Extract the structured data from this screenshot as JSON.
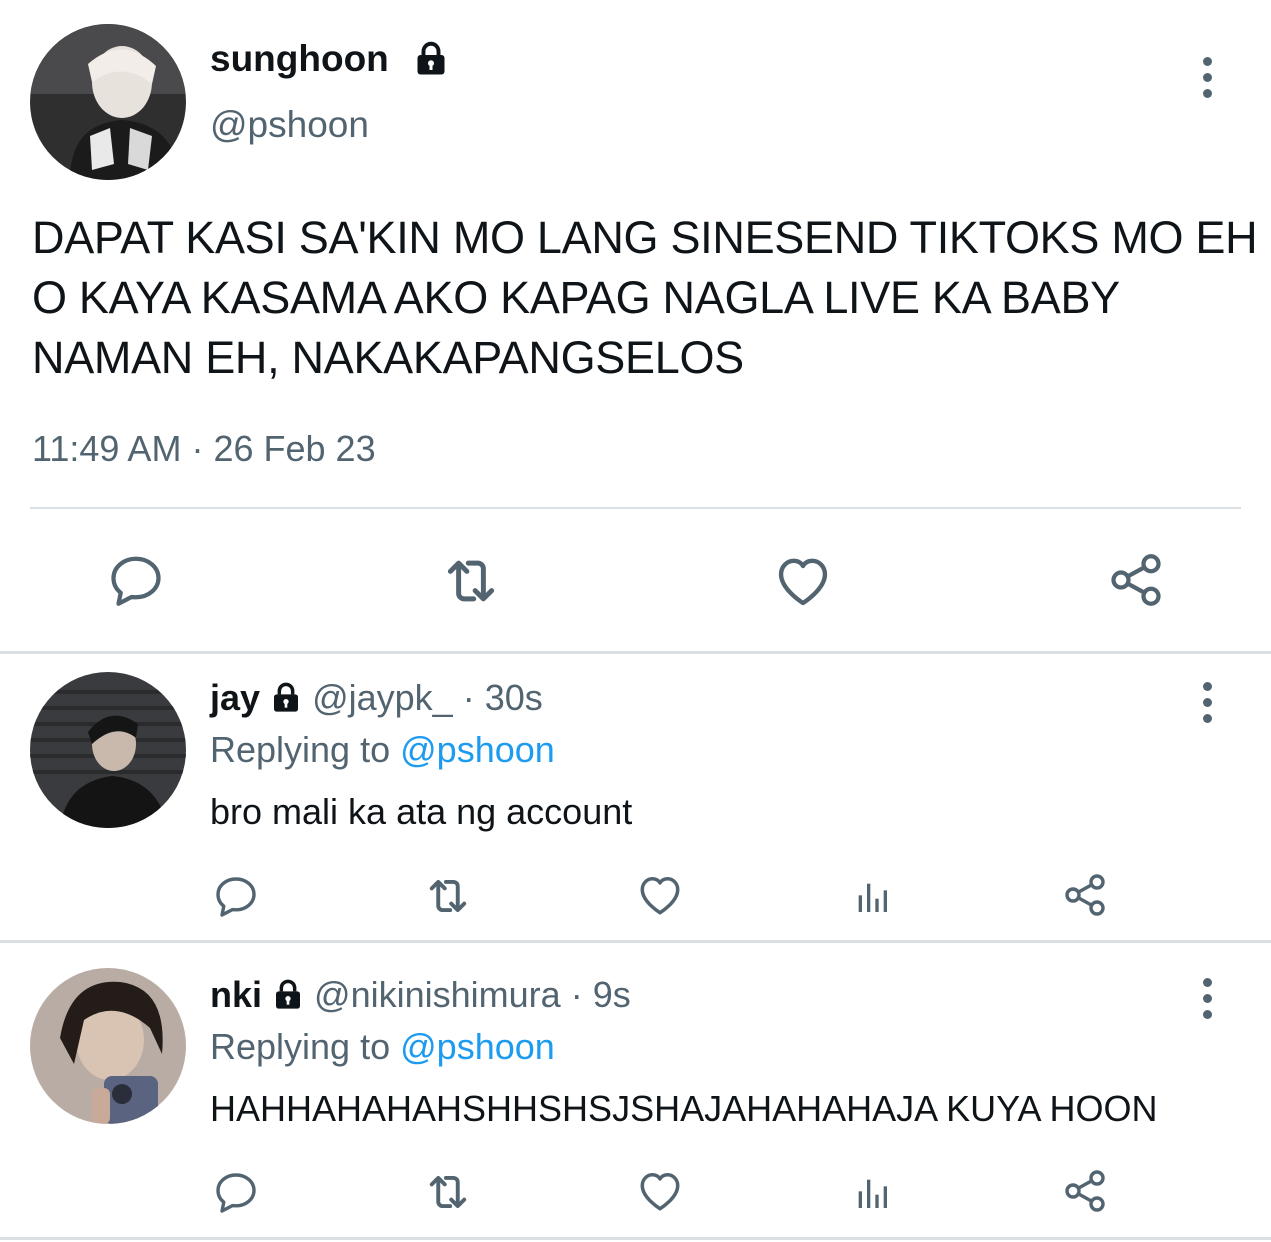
{
  "main_tweet": {
    "author_name": "sunghoon",
    "author_handle": "@pshoon",
    "text": "DAPAT KASI SA'KIN MO LANG SINESEND TIKTOKS MO EH O KAYA KASAMA AKO KAPAG NAGLA LIVE KA BABY NAMAN EH, NAKAKAPANGSELOS",
    "time": "11:49 AM",
    "separator": "·",
    "date": "26 Feb 23",
    "icons": {
      "lock": "lock-icon",
      "more": "more-vertical-icon",
      "reply": "reply-icon",
      "retweet": "retweet-icon",
      "like": "heart-icon",
      "share": "share-icon"
    }
  },
  "replies": [
    {
      "name": "jay",
      "handle": "@jaypk_",
      "dot": "·",
      "time": "30s",
      "replying_prefix": "Replying to",
      "replying_to": "@pshoon",
      "text": "bro mali ka ata ng account"
    },
    {
      "name": "nki",
      "handle": "@nikinishimura",
      "dot": "·",
      "time": "9s",
      "replying_prefix": "Replying to",
      "replying_to": "@pshoon",
      "text": "HAHHAHAHAHSHHSHSJSHAJAHAHAHAJA KUYA HOON"
    }
  ],
  "colors": {
    "text_primary": "#0f1419",
    "text_secondary": "#536471",
    "link": "#1d9bf0",
    "divider": "#dadfe3"
  }
}
